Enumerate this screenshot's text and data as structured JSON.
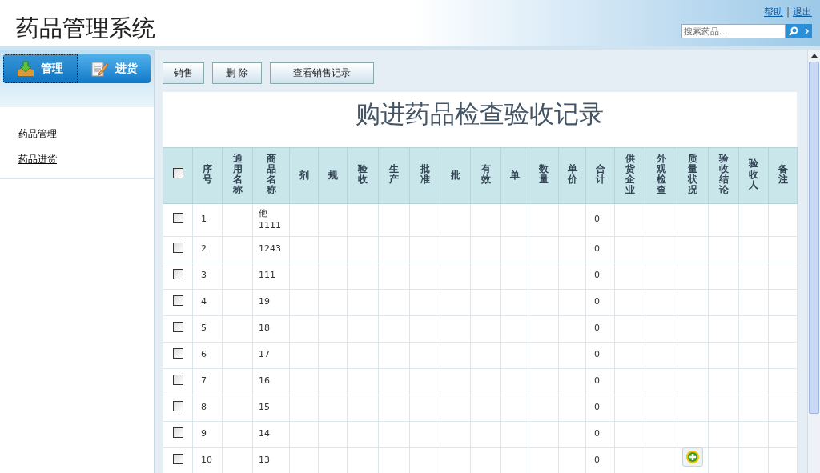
{
  "header": {
    "title": "药品管理系统",
    "links": [
      "帮助",
      "退出"
    ],
    "separator": "|",
    "search": {
      "placeholder": "搜索药品..."
    }
  },
  "sidebar": {
    "tabs": [
      {
        "label": "管理",
        "selected": true,
        "kind": "download"
      },
      {
        "label": "进货",
        "selected": false,
        "kind": "edit"
      }
    ],
    "items": [
      "药品管理",
      "药品进货"
    ]
  },
  "toolbar": {
    "buttons": [
      "销售",
      "删 除",
      "查看销售记录"
    ]
  },
  "report": {
    "title": "购进药品检查验收记录",
    "columns": [
      "序号",
      "通用名称",
      "商品名称",
      "剂",
      "规",
      "验收",
      "生产",
      "批准",
      "批",
      "有效",
      "单",
      "数量",
      "单价",
      "合计",
      "供货企业",
      "外观检查",
      "质量状况",
      "验收结论",
      "验收人",
      "备注"
    ],
    "select_all_checked": false,
    "rows": [
      {
        "checked": false,
        "no": "1",
        "trade_name": "他1111",
        "total": "0"
      },
      {
        "checked": false,
        "no": "2",
        "trade_name": "1243",
        "total": "0"
      },
      {
        "checked": false,
        "no": "3",
        "trade_name": "111",
        "total": "0"
      },
      {
        "checked": false,
        "no": "4",
        "trade_name": "19",
        "total": "0"
      },
      {
        "checked": false,
        "no": "5",
        "trade_name": "18",
        "total": "0"
      },
      {
        "checked": false,
        "no": "6",
        "trade_name": "17",
        "total": "0"
      },
      {
        "checked": false,
        "no": "7",
        "trade_name": "16",
        "total": "0"
      },
      {
        "checked": false,
        "no": "8",
        "trade_name": "15",
        "total": "0"
      },
      {
        "checked": false,
        "no": "9",
        "trade_name": "14",
        "total": "0"
      },
      {
        "checked": false,
        "no": "10",
        "trade_name": "13",
        "total": "0"
      }
    ]
  }
}
